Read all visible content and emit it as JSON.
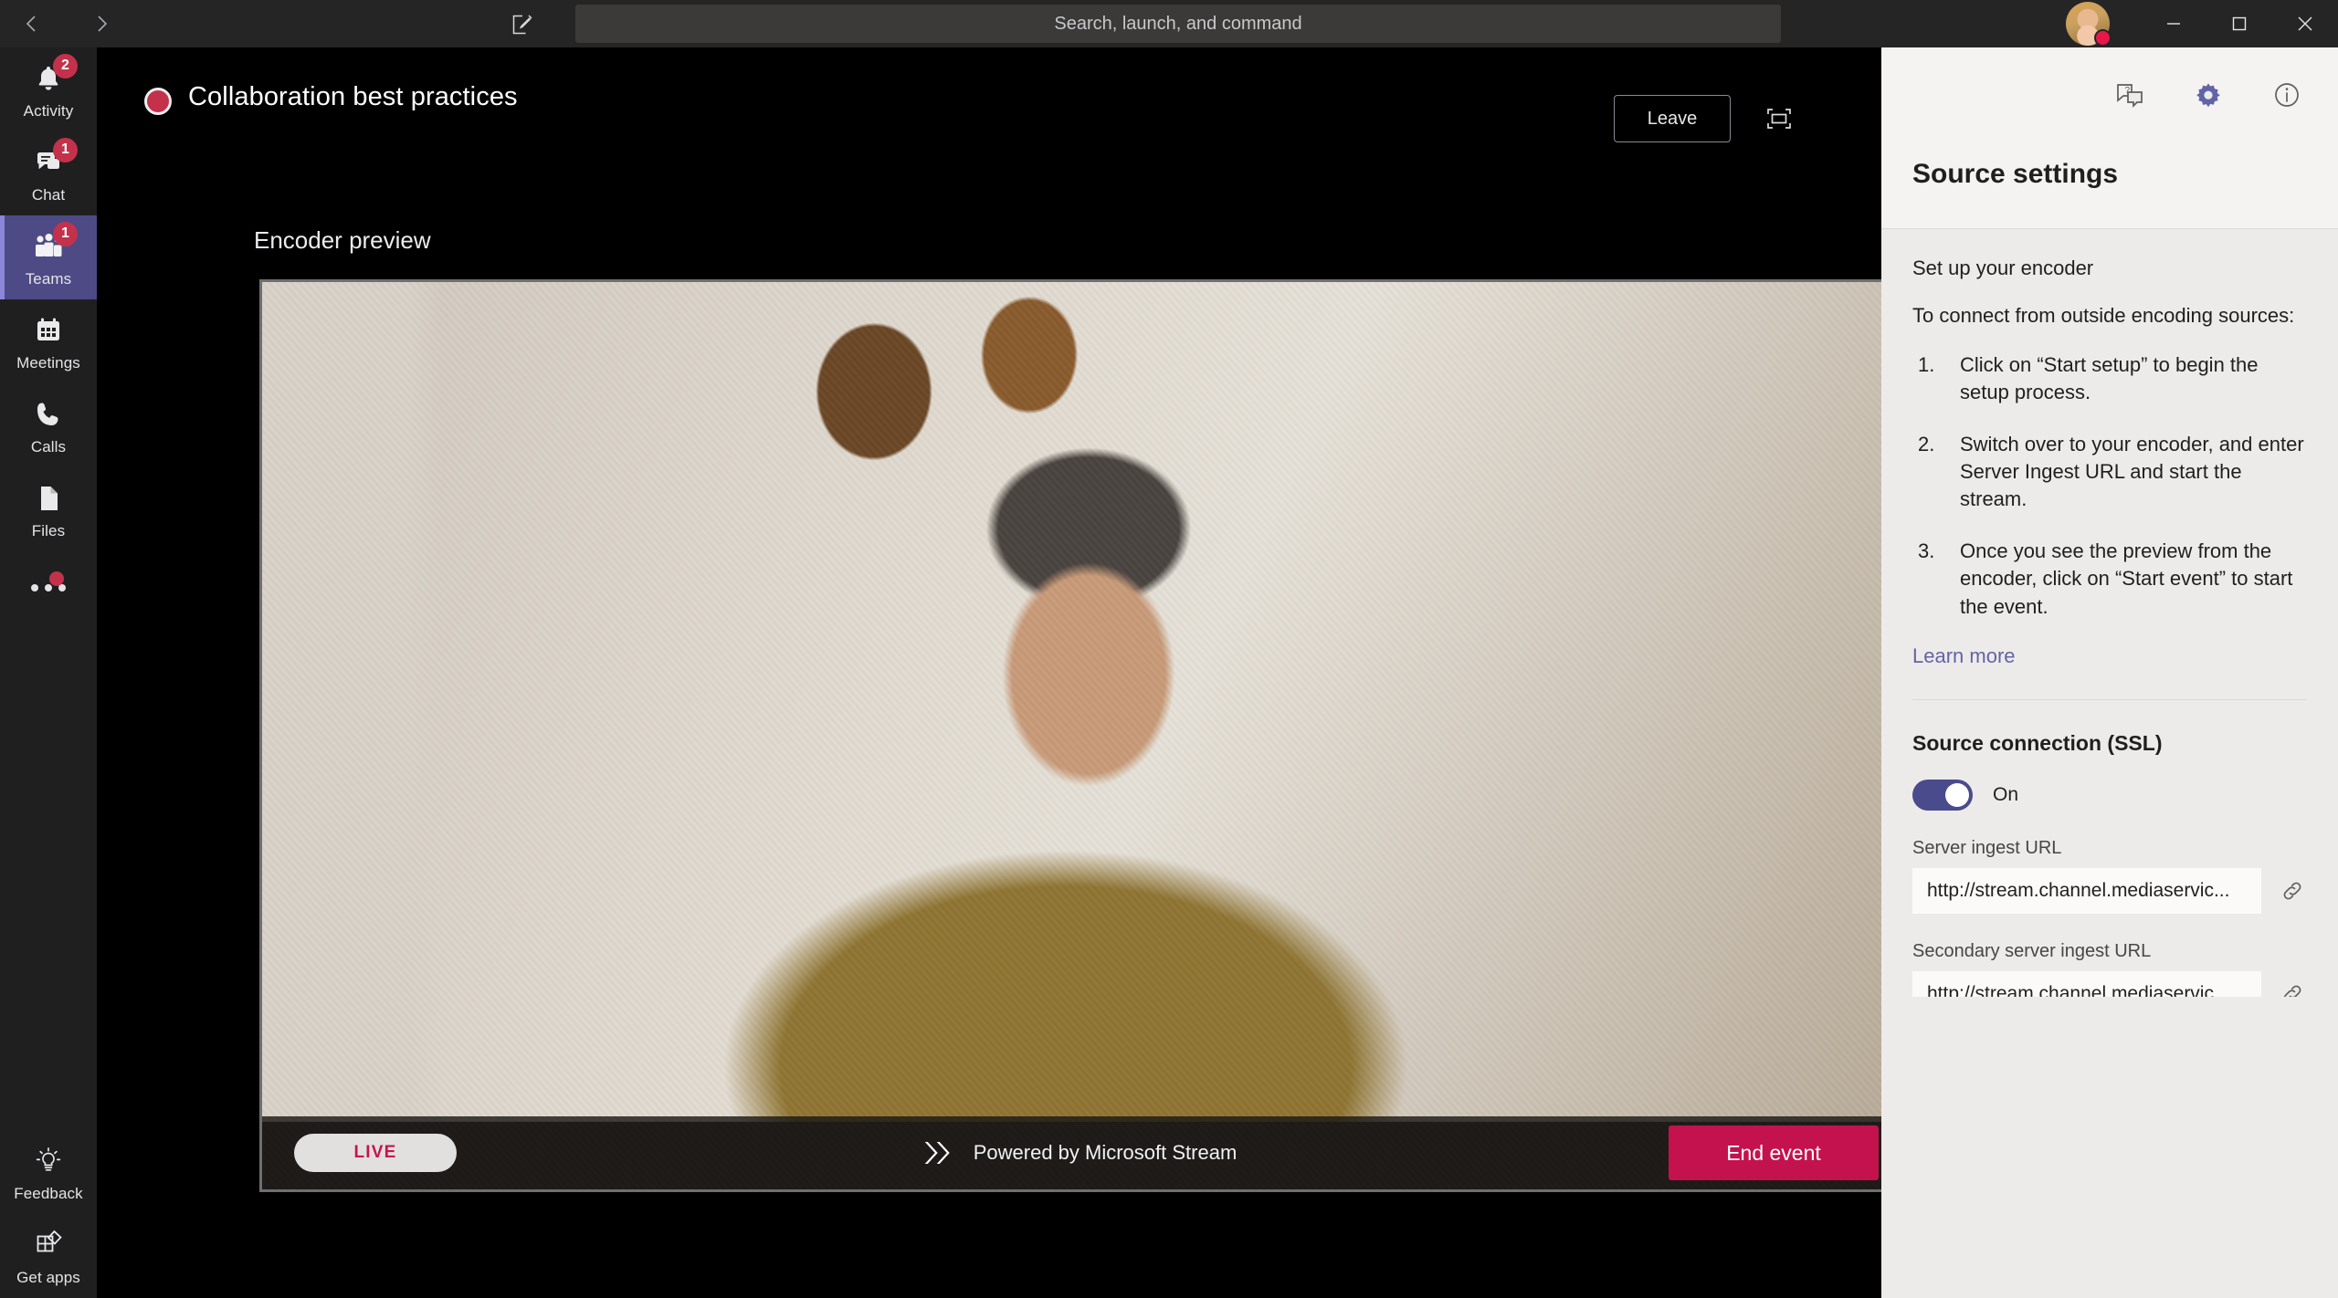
{
  "titlebar": {
    "back_icon": "chevron-left-icon",
    "forward_icon": "chevron-right-icon",
    "compose_icon": "compose-icon",
    "search_placeholder": "Search, launch, and command",
    "search_value": "",
    "minimize_label": "Minimize",
    "maximize_label": "Maximize",
    "close_label": "Close",
    "presence_status": "busy"
  },
  "rail": {
    "items": [
      {
        "label": "Activity",
        "icon": "bell-icon",
        "badge": "2",
        "active": false
      },
      {
        "label": "Chat",
        "icon": "chat-icon",
        "badge": "1",
        "active": false
      },
      {
        "label": "Teams",
        "icon": "people-icon",
        "badge": "1",
        "active": true
      },
      {
        "label": "Meetings",
        "icon": "calendar-icon",
        "badge": "",
        "active": false
      },
      {
        "label": "Calls",
        "icon": "phone-icon",
        "badge": "",
        "active": false
      },
      {
        "label": "Files",
        "icon": "file-icon",
        "badge": "",
        "active": false
      }
    ],
    "more_label": "More apps",
    "bottom": [
      {
        "label": "Feedback",
        "icon": "lightbulb-icon"
      },
      {
        "label": "Get apps",
        "icon": "get-apps-icon"
      }
    ]
  },
  "meeting": {
    "title": "Collaboration best practices",
    "recording_indicator": "recording-dot",
    "leave_label": "Leave",
    "fullscreen_icon": "fullscreen-icon",
    "preview_label": "Encoder preview"
  },
  "player": {
    "live_label": "LIVE",
    "brand_text": "Powered by Microsoft Stream",
    "brand_icon": "stream-logo-icon",
    "end_event_label": "End event",
    "accent_pink": "#c4124f",
    "live_text_color": "#c4154f"
  },
  "panel": {
    "tools": [
      {
        "name": "qna-icon",
        "label": "Q&A"
      },
      {
        "name": "gear-icon",
        "label": "Settings"
      },
      {
        "name": "info-icon",
        "label": "Info"
      }
    ],
    "active_tool_color": "#6264a7",
    "title": "Source settings",
    "section_heading": "Set up your encoder",
    "section_sub": "To connect from outside encoding sources:",
    "steps": [
      "Click on “Start setup” to begin the setup process.",
      "Switch over to your encoder, and enter Server Ingest URL and start the stream.",
      "Once you see the preview from the encoder, click on “Start event” to start the event."
    ],
    "learn_more": "Learn more",
    "ssl_heading": "Source connection (SSL)",
    "ssl_state_label": "On",
    "ssl_on": true,
    "fields": [
      {
        "label": "Server ingest URL",
        "value": "http://stream.channel.mediaservic...",
        "copy_icon": "link-icon"
      },
      {
        "label": "Secondary server ingest URL",
        "value": "http://stream.channel.mediaservic...",
        "copy_icon": "link-icon"
      }
    ]
  }
}
